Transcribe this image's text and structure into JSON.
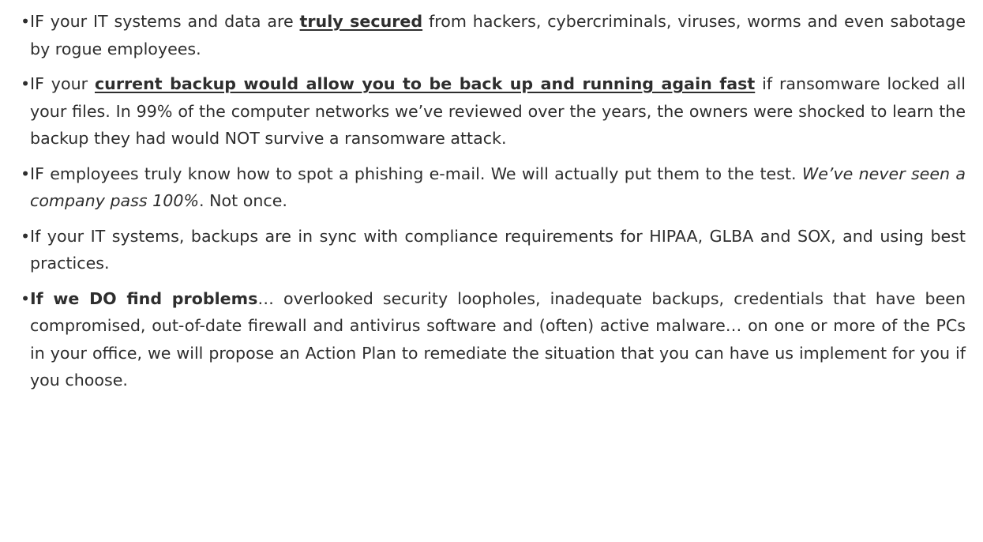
{
  "bullet_glyph": "•",
  "items": [
    {
      "t1": "IF your IT systems and data are ",
      "em": "truly secured",
      "t2": " from hackers, cybercriminals, viruses, worms and even sabotage by rogue employees."
    },
    {
      "t1": "IF your ",
      "em": "current backup would allow you to be back up and running again fast",
      "t2": " if ransomware locked all your files. In 99% of the computer networks we’ve reviewed over the years, the owners were shocked to learn the backup they had would NOT survive a ransomware attack."
    },
    {
      "t1": "IF employees truly know how to spot a phishing e-mail. We will actually put them to the test. ",
      "em": "We’ve never seen a company pass 100%",
      "t2": ". Not once."
    },
    {
      "t1": "If your IT systems, backups are in sync with compliance requirements for HIPAA, GLBA and SOX, and using best practices."
    },
    {
      "em": "If we DO find problems",
      "t2": "… overlooked security loopholes, inadequate backups, credentials that have been compromised, out-of-date firewall and antivirus software and (often) active malware… on one or more of the PCs in your office, we will propose an Action Plan to remediate the situation that you can have us implement for you if you choose."
    }
  ]
}
